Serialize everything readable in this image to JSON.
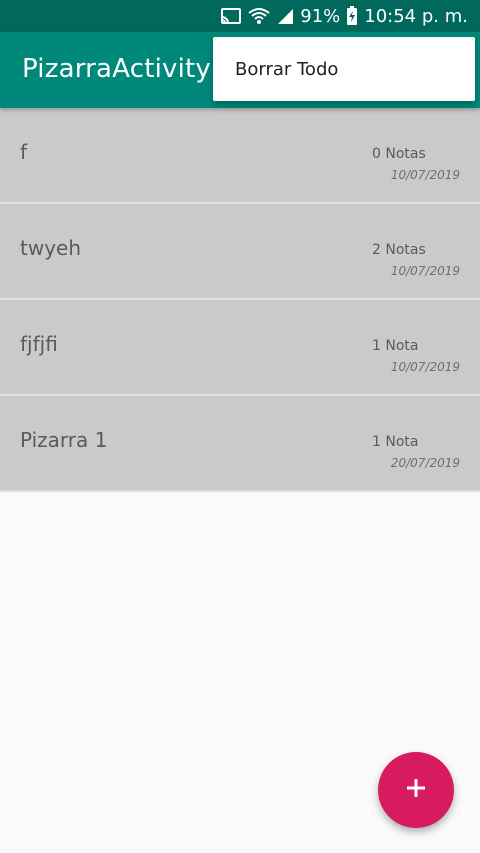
{
  "status_bar": {
    "battery": "91%",
    "time": "10:54 p. m.",
    "icons": [
      "cast-icon",
      "wifi-icon",
      "signal-icon",
      "battery-icon"
    ]
  },
  "app_bar": {
    "title": "PizarraActivity"
  },
  "overflow_menu": {
    "items": [
      {
        "label": "Borrar Todo"
      }
    ]
  },
  "list": {
    "items": [
      {
        "name": "f",
        "count": "0 Notas",
        "date": "10/07/2019"
      },
      {
        "name": "twyeh",
        "count": "2 Notas",
        "date": "10/07/2019"
      },
      {
        "name": "fjfjfi",
        "count": "1 Nota",
        "date": "10/07/2019"
      },
      {
        "name": "Pizarra 1",
        "count": "1 Nota",
        "date": "20/07/2019"
      }
    ]
  },
  "fab": {
    "icon": "plus-icon",
    "color": "#d81b60"
  },
  "colors": {
    "primary": "#00897b",
    "primary_dark": "#00695c",
    "accent": "#d81b60",
    "item_bg": "#cacaca"
  }
}
